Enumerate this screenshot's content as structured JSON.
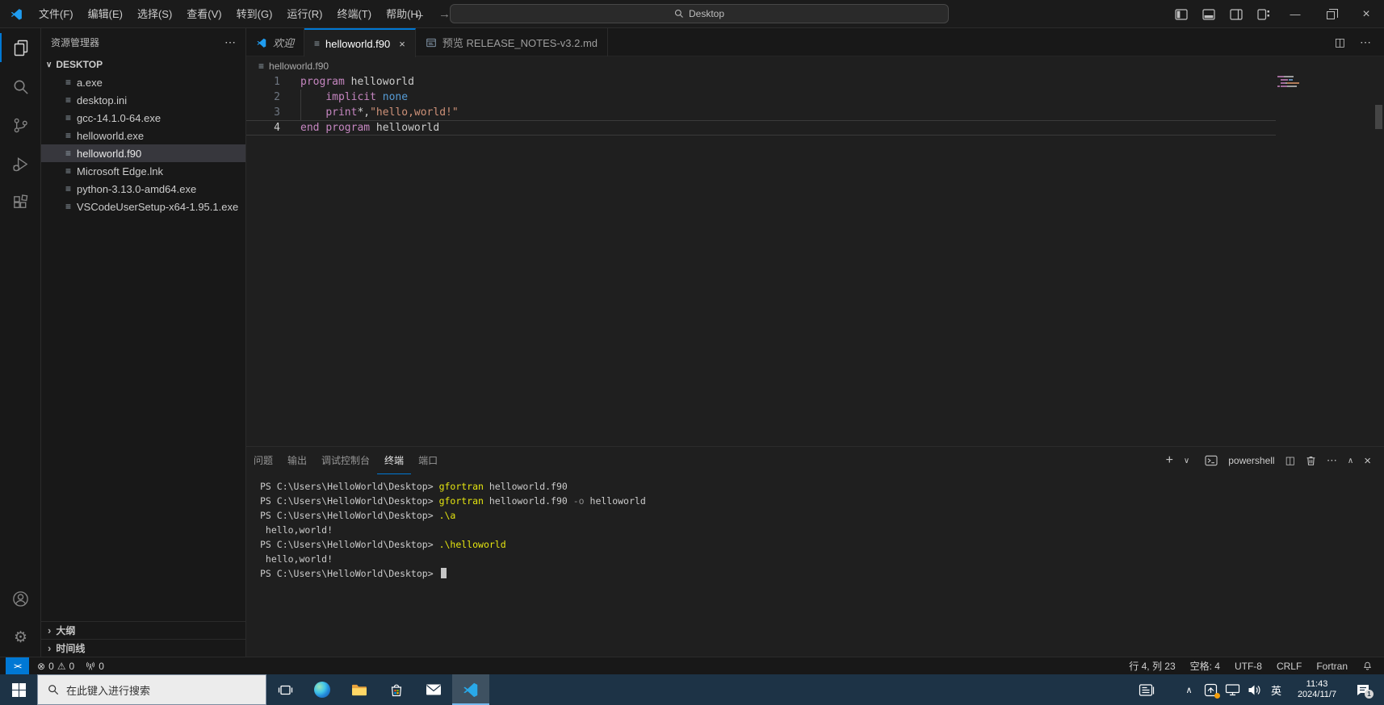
{
  "titlebar": {
    "menus": [
      "文件(F)",
      "编辑(E)",
      "选择(S)",
      "查看(V)",
      "转到(G)",
      "运行(R)",
      "终端(T)",
      "帮助(H)"
    ],
    "search": "Desktop"
  },
  "explorer": {
    "title": "资源管理器",
    "root": "DESKTOP",
    "files": [
      "a.exe",
      "desktop.ini",
      "gcc-14.1.0-64.exe",
      "helloworld.exe",
      "helloworld.f90",
      "Microsoft Edge.lnk",
      "python-3.13.0-amd64.exe",
      "VSCodeUserSetup-x64-1.95.1.exe"
    ],
    "selected": "helloworld.f90",
    "sections": [
      "大纲",
      "时间线"
    ]
  },
  "tabs": {
    "welcome": "欢迎",
    "active": "helloworld.f90",
    "preview": "预览 RELEASE_NOTES-v3.2.md"
  },
  "breadcrumb": "helloworld.f90",
  "editor": {
    "lines": [
      {
        "num": "1",
        "tokens": [
          [
            "program",
            "kw"
          ],
          [
            " helloworld",
            "pl"
          ]
        ]
      },
      {
        "num": "2",
        "tokens": [
          [
            "    ",
            "sp"
          ],
          [
            "implicit",
            "kw"
          ],
          [
            " ",
            "sp"
          ],
          [
            "none",
            "ty"
          ]
        ]
      },
      {
        "num": "3",
        "tokens": [
          [
            "    ",
            "sp"
          ],
          [
            "print",
            "kw"
          ],
          [
            "*,",
            "pl"
          ],
          [
            "\"hello,world!\"",
            "st"
          ]
        ]
      },
      {
        "num": "4",
        "tokens": [
          [
            "end",
            "kw"
          ],
          [
            " ",
            "sp"
          ],
          [
            "program",
            "kw"
          ],
          [
            " helloworld",
            "pl"
          ]
        ],
        "current": true
      }
    ]
  },
  "panel": {
    "tabs": [
      "问题",
      "输出",
      "调试控制台",
      "终端",
      "端口"
    ],
    "active_tab": "终端",
    "shell": "powershell",
    "terminal": [
      [
        [
          "PS C:\\Users\\HelloWorld\\Desktop> ",
          "pl"
        ],
        [
          "gfortran",
          "cmd"
        ],
        [
          " helloworld.f90",
          "pl"
        ]
      ],
      [
        [
          "PS C:\\Users\\HelloWorld\\Desktop> ",
          "pl"
        ],
        [
          "gfortran",
          "cmd"
        ],
        [
          " helloworld.f90 ",
          "pl"
        ],
        [
          "-o",
          "par"
        ],
        [
          " helloworld",
          "pl"
        ]
      ],
      [
        [
          "PS C:\\Users\\HelloWorld\\Desktop> ",
          "pl"
        ],
        [
          ".\\a",
          "cmd"
        ]
      ],
      [
        [
          " hello,world!",
          "pl"
        ]
      ],
      [
        [
          "PS C:\\Users\\HelloWorld\\Desktop> ",
          "pl"
        ],
        [
          ".\\helloworld",
          "cmd"
        ]
      ],
      [
        [
          " hello,world!",
          "pl"
        ]
      ],
      [
        [
          "PS C:\\Users\\HelloWorld\\Desktop> ",
          "pl"
        ]
      ]
    ]
  },
  "statusbar": {
    "remote": "><",
    "errors": "0",
    "warnings": "0",
    "ports": "0",
    "cursor": "行 4, 列 23",
    "indent": "空格: 4",
    "encoding": "UTF-8",
    "eol": "CRLF",
    "language": "Fortran"
  },
  "taskbar": {
    "search_placeholder": "在此键入进行搜索",
    "ime": "英",
    "time": "11:43",
    "date": "2024/11/7",
    "badge": "1"
  },
  "icons": {
    "more": "⋯",
    "chevron-down": "∨",
    "chevron-up": "∧",
    "chevron-right": "›",
    "close": "×",
    "minimize": "—",
    "split": "◫",
    "add": "+",
    "gear": "⚙",
    "file": "≡",
    "error": "⊗",
    "warning": "⚠"
  },
  "colors": {
    "accent": "#0078d4",
    "keyword": "#c586c0",
    "type": "#569cd6",
    "string": "#ce9178",
    "terminal_command": "#e5e510"
  }
}
